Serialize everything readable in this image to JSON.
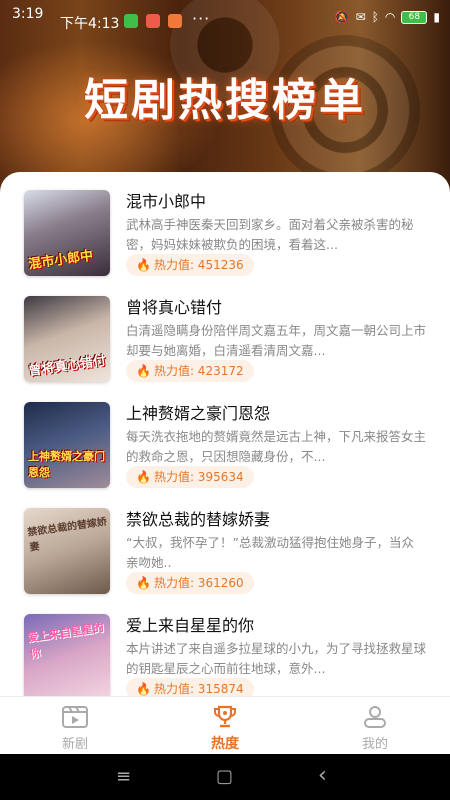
{
  "status_bar": {
    "time": "3:19",
    "time2": "下午4:13",
    "dots": "···",
    "battery": "68"
  },
  "banner": {
    "title": "短剧热搜榜单"
  },
  "colors": {
    "accent": "#e8742a",
    "heat_bg": "#fdf0e6"
  },
  "items": [
    {
      "title": "混市小郎中",
      "desc": "武林高手神医秦天回到家乡。面对着父亲被杀害的秘密，妈妈妹妹被欺负的困境，看着这...",
      "heat": "热力值: 451236",
      "cover_text": "混市小郎中"
    },
    {
      "title": "曾将真心错付",
      "desc": "白清遥隐瞒身份陪伴周文嘉五年，周文嘉一朝公司上市却要与她离婚，白清遥看清周文嘉...",
      "heat": "热力值: 423172",
      "cover_text": "曾将真心错付"
    },
    {
      "title": "上神赘婿之豪门恩怨",
      "desc": "每天洗衣拖地的赘婿竟然是远古上神，下凡来报答女主的救命之恩，只因想隐藏身份，不...",
      "heat": "热力值: 395634",
      "cover_text": "上神赘婿之豪门恩怨"
    },
    {
      "title": "禁欲总裁的替嫁娇妻",
      "desc": "“大叔，我怀孕了！”总裁激动猛得抱住她身子，当众亲吻她..",
      "heat": "热力值: 361260",
      "cover_text": "禁欲总裁的替嫁娇妻"
    },
    {
      "title": "爱上来自星星的你",
      "desc": "本片讲述了来自遥多拉星球的小九，为了寻找拯救星球的钥匙星辰之心而前往地球，意外...",
      "heat": "热力值: 315874",
      "cover_text": "爱上来自星星的你"
    }
  ],
  "tabs": [
    {
      "label": "新剧",
      "icon": "film-icon"
    },
    {
      "label": "热度",
      "icon": "trophy-icon"
    },
    {
      "label": "我的",
      "icon": "user-icon"
    }
  ],
  "nav": {
    "menu": "≡",
    "home": "▢",
    "back": "‹"
  }
}
